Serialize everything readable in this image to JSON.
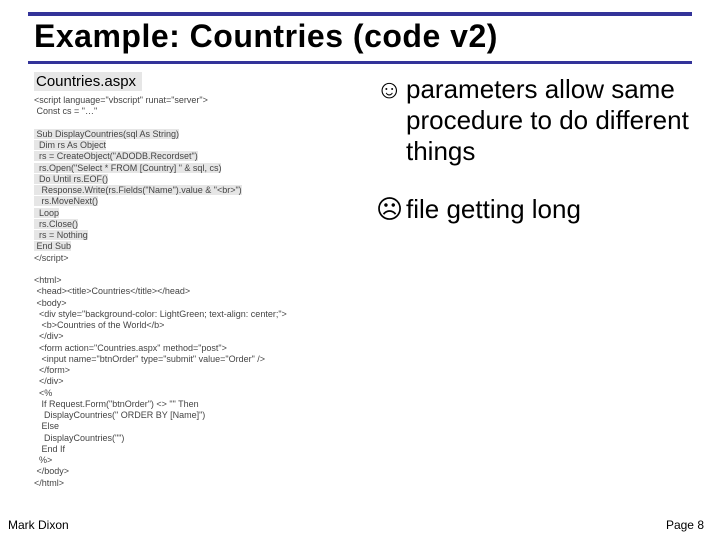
{
  "header": {
    "title": "Example: Countries (code v2)"
  },
  "left": {
    "filename": "Countries.aspx",
    "code_line_01": "<script language=\"vbscript\" runat=\"server\">",
    "code_line_02": " Const cs = \"…\"",
    "code_line_03": "",
    "code_line_04": " Sub DisplayCountries(sql As String)",
    "code_line_05": "  Dim rs As Object",
    "code_line_06": "  rs = CreateObject(\"ADODB.Recordset\")",
    "code_line_07": "  rs.Open(\"Select * FROM [Country] \" & sql, cs)",
    "code_line_08": "  Do Until rs.EOF()",
    "code_line_09": "   Response.Write(rs.Fields(\"Name\").value & \"<br>\")",
    "code_line_10": "   rs.MoveNext()",
    "code_line_11": "  Loop",
    "code_line_12": "  rs.Close()",
    "code_line_13": "  rs = Nothing",
    "code_line_14": " End Sub",
    "code_line_15": "</script>",
    "code_line_16": "",
    "code_line_17": "<html>",
    "code_line_18": " <head><title>Countries</title></head>",
    "code_line_19": " <body>",
    "code_line_20": "  <div style=\"background-color: LightGreen; text-align: center;\">",
    "code_line_21": "   <b>Countries of the World</b>",
    "code_line_22": "  </div>",
    "code_line_23": "  <form action=\"Countries.aspx\" method=\"post\">",
    "code_line_24": "   <input name=\"btnOrder\" type=\"submit\" value=\"Order\" />",
    "code_line_25": "  </form>",
    "code_line_26": "  </div>",
    "code_line_27": "  <%",
    "code_line_28": "   If Request.Form(\"btnOrder\") <> \"\" Then",
    "code_line_29": "    DisplayCountries(\" ORDER BY [Name]\")",
    "code_line_30": "   Else",
    "code_line_31": "    DisplayCountries(\"\")",
    "code_line_32": "   End If",
    "code_line_33": "  %>",
    "code_line_34": " </body>",
    "code_line_35": "</html>"
  },
  "bullets": {
    "b1_face": "☺",
    "b1_text": "parameters allow same procedure to do different things",
    "b2_face": "☹",
    "b2_text": "file getting long"
  },
  "footer": {
    "left": "Mark Dixon",
    "right": "Page 8"
  }
}
